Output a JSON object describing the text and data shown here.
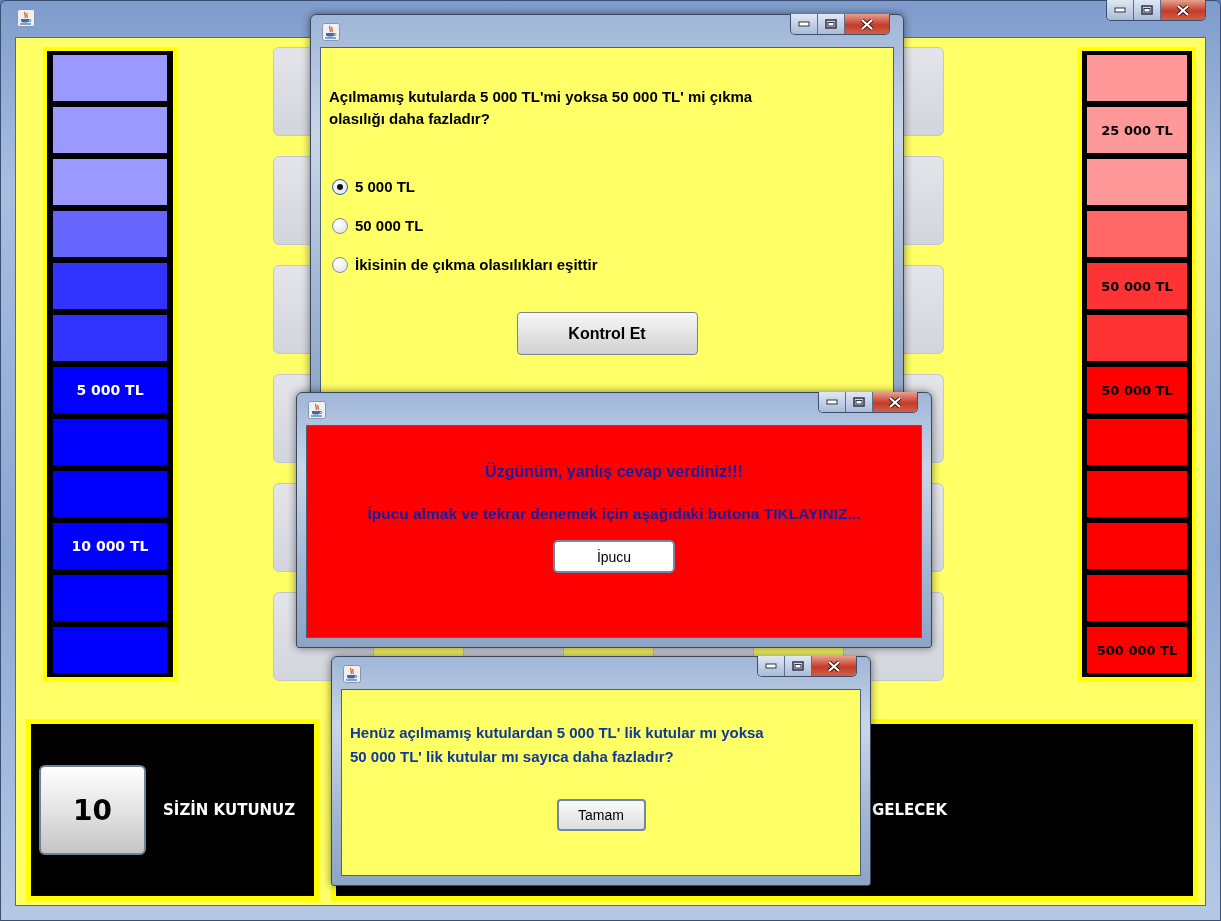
{
  "main_window": {
    "left_column": {
      "tiers": [
        {
          "color": "#9999ff"
        },
        {
          "color": "#9999ff"
        },
        {
          "color": "#9999ff"
        },
        {
          "color": "#6666ff"
        },
        {
          "color": "#3333ff"
        },
        {
          "color": "#3333ff"
        },
        {
          "label": "5 000 TL",
          "color": "#0000ff"
        },
        {
          "color": "#0000ff"
        },
        {
          "color": "#0000ff"
        },
        {
          "label": "10 000 TL",
          "color": "#0000ff"
        },
        {
          "color": "#0000ff"
        },
        {
          "color": "#0000ff"
        }
      ]
    },
    "right_column": {
      "tiers": [
        {
          "color": "#ff9999"
        },
        {
          "label": "25 000 TL",
          "color": "#ff9999"
        },
        {
          "color": "#ff9999"
        },
        {
          "color": "#ff6666"
        },
        {
          "label": "50 000 TL",
          "color": "#ff3333"
        },
        {
          "color": "#ff3333"
        },
        {
          "label": "50 000 TL",
          "color": "#ff0000"
        },
        {
          "color": "#ff0000"
        },
        {
          "color": "#ff0000"
        },
        {
          "color": "#ff0000"
        },
        {
          "color": "#ff0000"
        },
        {
          "label": "500 000 TL",
          "color": "#ff0000"
        }
      ]
    },
    "your_box": {
      "number": "10",
      "label": "SİZİN KUTUNUZ"
    },
    "offer_panel": {
      "text": "GELECEK"
    }
  },
  "question_dialog": {
    "question": "Açılmamış kutularda 5 000 TL'mi yoksa 50 000 TL' mi çıkma\nolasılığı daha fazladır?",
    "options": [
      {
        "label": "5 000 TL",
        "selected": true
      },
      {
        "label": "50 000 TL",
        "selected": false
      },
      {
        "label": "İkisinin de çıkma olasılıkları eşittir",
        "selected": false
      }
    ],
    "button": "Kontrol Et"
  },
  "wrong_dialog": {
    "heading": "Üzgünüm, yanlış cevap verdiniz!!!",
    "message": "İpucu almak ve tekrar denemek için aşağıdaki butona TIKLAYINIZ...",
    "button": "İpucu"
  },
  "hint_dialog": {
    "message": "Henüz açılmamış kutulardan 5 000 TL' lik kutular mı yoksa\n50 000 TL' lik kutular mı sayıca daha fazladır?",
    "button": "Tamam"
  }
}
